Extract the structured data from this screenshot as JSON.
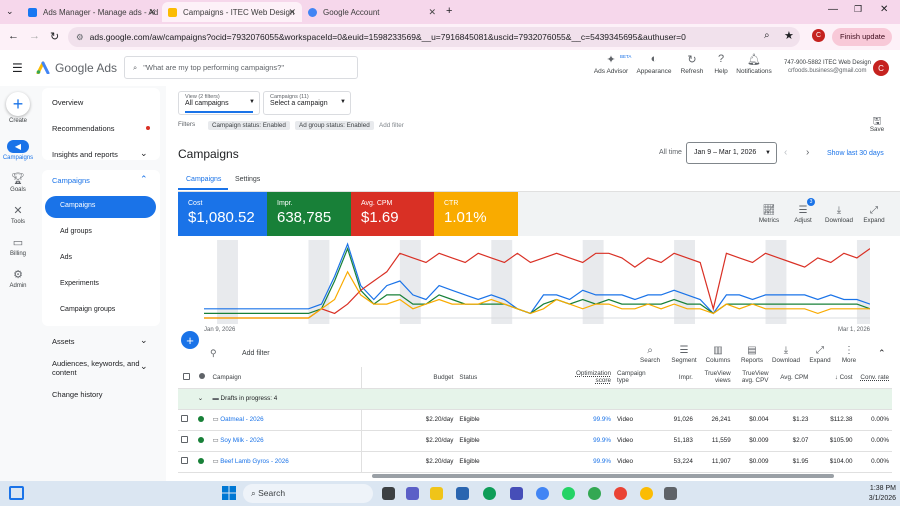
{
  "browser": {
    "tabs": [
      {
        "title": "Ads Manager - Manage ads - Ad",
        "color": "#1877f2"
      },
      {
        "title": "Campaigns - ITEC Web Design",
        "color": "#fbbc04"
      },
      {
        "title": "Google Account",
        "color": "#4285f4"
      }
    ],
    "url": "ads.google.com/aw/campaigns?ocid=7932076055&workspaceId=0&euid=1598233569&__u=7916845081&uscid=7932076055&__c=5439345695&authuser=0",
    "profile_initial": "C",
    "finish_update": "Finish update"
  },
  "header": {
    "logo": "Google Ads",
    "search_placeholder": "\"What are my top performing campaigns?\"",
    "beta": "BETA",
    "buttons": [
      "Ads Advisor",
      "Appearance",
      "Refresh",
      "Help",
      "Notifications"
    ],
    "account_line1": "747-900-5882 ITEC Web Design",
    "account_line2": "crfoods.business@gmail.com",
    "avatar": "C"
  },
  "rail": [
    "Create",
    "Campaigns",
    "Goals",
    "Tools",
    "Billing",
    "Admin"
  ],
  "nav": {
    "overview": "Overview",
    "recommendations": "Recommendations",
    "insights": "Insights and reports",
    "campaigns": "Campaigns",
    "sub": [
      "Campaigns",
      "Ad groups",
      "Ads",
      "Experiments",
      "Campaign groups"
    ],
    "assets": "Assets",
    "audiences": "Audiences, keywords, and",
    "audiences2": "content",
    "change_history": "Change history"
  },
  "selectors": {
    "view_label": "View (2 filters)",
    "view_value": "All campaigns",
    "campaigns_label": "Campaigns (11)",
    "campaigns_value": "Select a campaign",
    "save": "Save"
  },
  "filters": {
    "label": "Filters",
    "chips": [
      "Campaign status: Enabled",
      "Ad group status: Enabled"
    ],
    "add": "Add filter"
  },
  "page": {
    "title": "Campaigns",
    "all_time": "All time",
    "date_range": "Jan 9 – Mar 1, 2026",
    "show_last": "Show last 30 days",
    "tabs": [
      "Campaigns",
      "Settings"
    ]
  },
  "metrics": [
    {
      "label": "Cost",
      "value": "$1,080.52",
      "color": "#1a73e8"
    },
    {
      "label": "Impr.",
      "value": "638,785",
      "color": "#188038"
    },
    {
      "label": "Avg. CPM",
      "value": "$1.69",
      "color": "#d93025"
    },
    {
      "label": "CTR",
      "value": "1.01%",
      "color": "#f9ab00"
    }
  ],
  "chart_tools": [
    "Metrics",
    "Adjust",
    "Download",
    "Expand"
  ],
  "adjust_badge": "3",
  "chart_data": {
    "type": "line",
    "x_start": "Jan 9, 2026",
    "x_end": "Mar 1, 2026",
    "series": [
      {
        "name": "Cost",
        "color": "#1a73e8",
        "values": [
          2,
          2,
          2,
          2,
          2,
          2,
          2,
          2,
          2,
          3,
          9,
          16,
          7,
          4,
          7,
          8,
          5,
          4,
          7,
          6,
          5,
          4,
          5,
          4,
          2,
          1,
          5,
          5,
          4,
          6,
          5,
          5,
          5,
          4,
          5,
          5,
          6,
          5,
          4,
          1,
          5,
          5,
          4,
          5,
          5,
          5,
          5,
          4,
          5,
          4,
          4,
          3
        ]
      },
      {
        "name": "Impr.",
        "color": "#188038",
        "values": [
          1,
          1,
          1,
          1,
          1,
          1,
          1,
          1,
          1,
          2,
          8,
          15,
          6,
          3,
          5,
          5,
          3,
          3,
          5,
          4,
          3,
          3,
          3,
          3,
          2,
          1,
          3,
          4,
          3,
          4,
          3,
          4,
          3,
          3,
          3,
          3,
          4,
          3,
          3,
          1,
          3,
          3,
          3,
          3,
          3,
          3,
          3,
          3,
          3,
          3,
          3,
          2
        ]
      },
      {
        "name": "Avg. CPM",
        "color": "#d93025",
        "values": [
          0,
          0,
          0,
          0,
          0,
          0,
          0,
          0,
          0,
          2,
          1,
          3,
          6,
          8,
          10,
          14,
          13,
          12,
          14,
          13,
          12,
          14,
          13,
          12,
          14,
          12,
          13,
          14,
          13,
          12,
          14,
          14,
          13,
          11,
          13,
          12,
          14,
          13,
          12,
          2,
          14,
          13,
          12,
          14,
          13,
          12,
          11,
          13,
          12,
          14,
          13,
          15
        ]
      },
      {
        "name": "CTR",
        "color": "#f9ab00",
        "values": [
          0,
          0,
          0,
          0,
          0,
          0,
          0,
          0,
          0,
          2,
          4,
          10,
          5,
          3,
          3,
          4,
          2,
          3,
          4,
          3,
          3,
          3,
          4,
          3,
          2,
          1,
          2,
          4,
          3,
          2,
          3,
          3,
          2,
          2,
          3,
          2,
          3,
          2,
          2,
          1,
          3,
          2,
          3,
          2,
          2,
          2,
          2,
          1,
          2,
          2,
          2,
          2
        ]
      }
    ]
  },
  "table_tools": [
    "Search",
    "Segment",
    "Columns",
    "Reports",
    "Download",
    "Expand",
    "More"
  ],
  "add_filter": "Add filter",
  "table": {
    "headers": [
      "Campaign",
      "Budget",
      "Status",
      "Optimization score",
      "Campaign type",
      "Impr.",
      "TrueView views",
      "TrueView avg. CPV",
      "Avg. CPM",
      "Cost",
      "Conv. rate"
    ],
    "drafts": "Drafts in progress: 4",
    "rows": [
      {
        "name": "Oatmeal - 2026",
        "budget": "$2.20/day",
        "status": "Eligible",
        "opt": "99.9%",
        "type": "Video",
        "impr": "91,026",
        "views": "26,241",
        "cpv": "$0.004",
        "cpm": "$1.23",
        "cost": "$112.38",
        "conv": "0.00%"
      },
      {
        "name": "Soy Milk - 2026",
        "budget": "$2.20/day",
        "status": "Eligible",
        "opt": "99.9%",
        "type": "Video",
        "impr": "51,183",
        "views": "11,559",
        "cpv": "$0.009",
        "cpm": "$2.07",
        "cost": "$105.90",
        "conv": "0.00%"
      },
      {
        "name": "Beef Lamb Gyros - 2026",
        "budget": "$2.20/day",
        "status": "Eligible",
        "opt": "99.9%",
        "type": "Video",
        "impr": "53,224",
        "views": "11,907",
        "cpv": "$0.009",
        "cpm": "$1.95",
        "cost": "$104.00",
        "conv": "0.00%"
      }
    ]
  },
  "taskbar": {
    "search": "Search",
    "time": "1:38 PM",
    "date": "3/1/2026"
  }
}
